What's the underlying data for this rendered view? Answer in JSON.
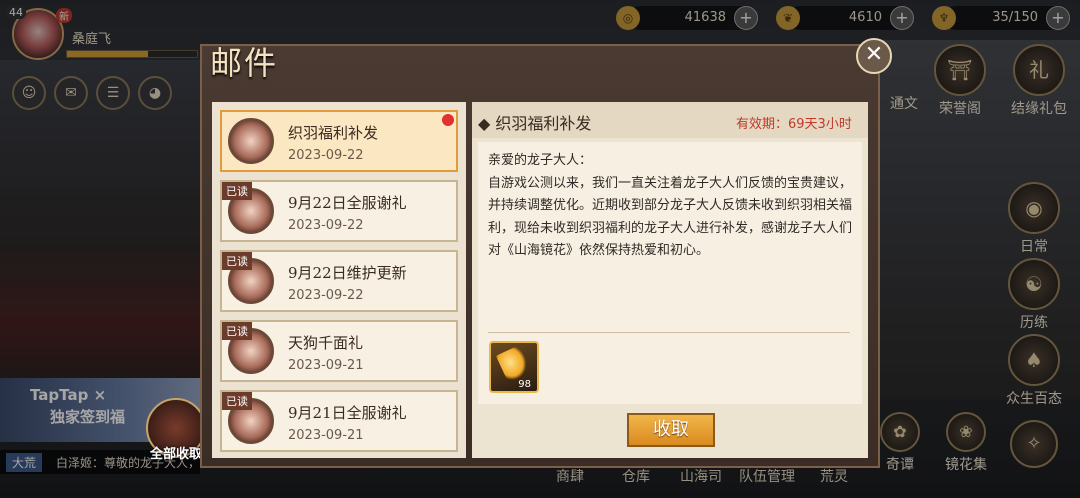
{
  "player": {
    "level": "44",
    "new_badge": "新",
    "name": "桑庭飞"
  },
  "resources": [
    {
      "icon": "coin-icon",
      "value": "41638"
    },
    {
      "icon": "gourd-icon",
      "value": "4610"
    },
    {
      "icon": "stamina-icon",
      "value": "35/150"
    }
  ],
  "right_menu": [
    "荣誉阁",
    "结缘礼包",
    "日常",
    "历练",
    "众生百态"
  ],
  "right_menu_partial": "通文",
  "bottom_nav": [
    "商肆",
    "仓库",
    "山海司",
    "队伍管理",
    "荒灵",
    "奇谭",
    "镜花集"
  ],
  "left_banner": {
    "brand": "TapTap",
    "cross": "×",
    "sub": "独家签到福"
  },
  "chat": {
    "tag": "大荒",
    "text": "白泽姬：尊敬的龙子大人，"
  },
  "collect_all": "全部收取",
  "dialog": {
    "title": "邮件",
    "mails": [
      {
        "title": "织羽福利补发",
        "date": "2023-09-22",
        "read": "",
        "active": true,
        "unread": true
      },
      {
        "title": "9月22日全服谢礼",
        "date": "2023-09-22",
        "read": "已读"
      },
      {
        "title": "9月22日维护更新",
        "date": "2023-09-22",
        "read": "已读"
      },
      {
        "title": "天狗千面礼",
        "date": "2023-09-21",
        "read": "已读"
      },
      {
        "title": "9月21日全服谢礼",
        "date": "2023-09-21",
        "read": "已读"
      }
    ],
    "detail": {
      "title": "织羽福利补发",
      "validity": "有效期：69天3小时",
      "body": "亲爱的龙子大人：\n自游戏公测以来，我们一直关注着龙子大人们反馈的宝贵建议，并持续调整优化。近期收到部分龙子大人反馈未收到织羽相关福利，现给未收到织羽福利的龙子大人进行补发，感谢龙子大人们对《山海镜花》依然保持热爱和初心。",
      "attachment": {
        "icon": "golden-feather-icon",
        "count": "98"
      },
      "claim": "收取"
    }
  }
}
